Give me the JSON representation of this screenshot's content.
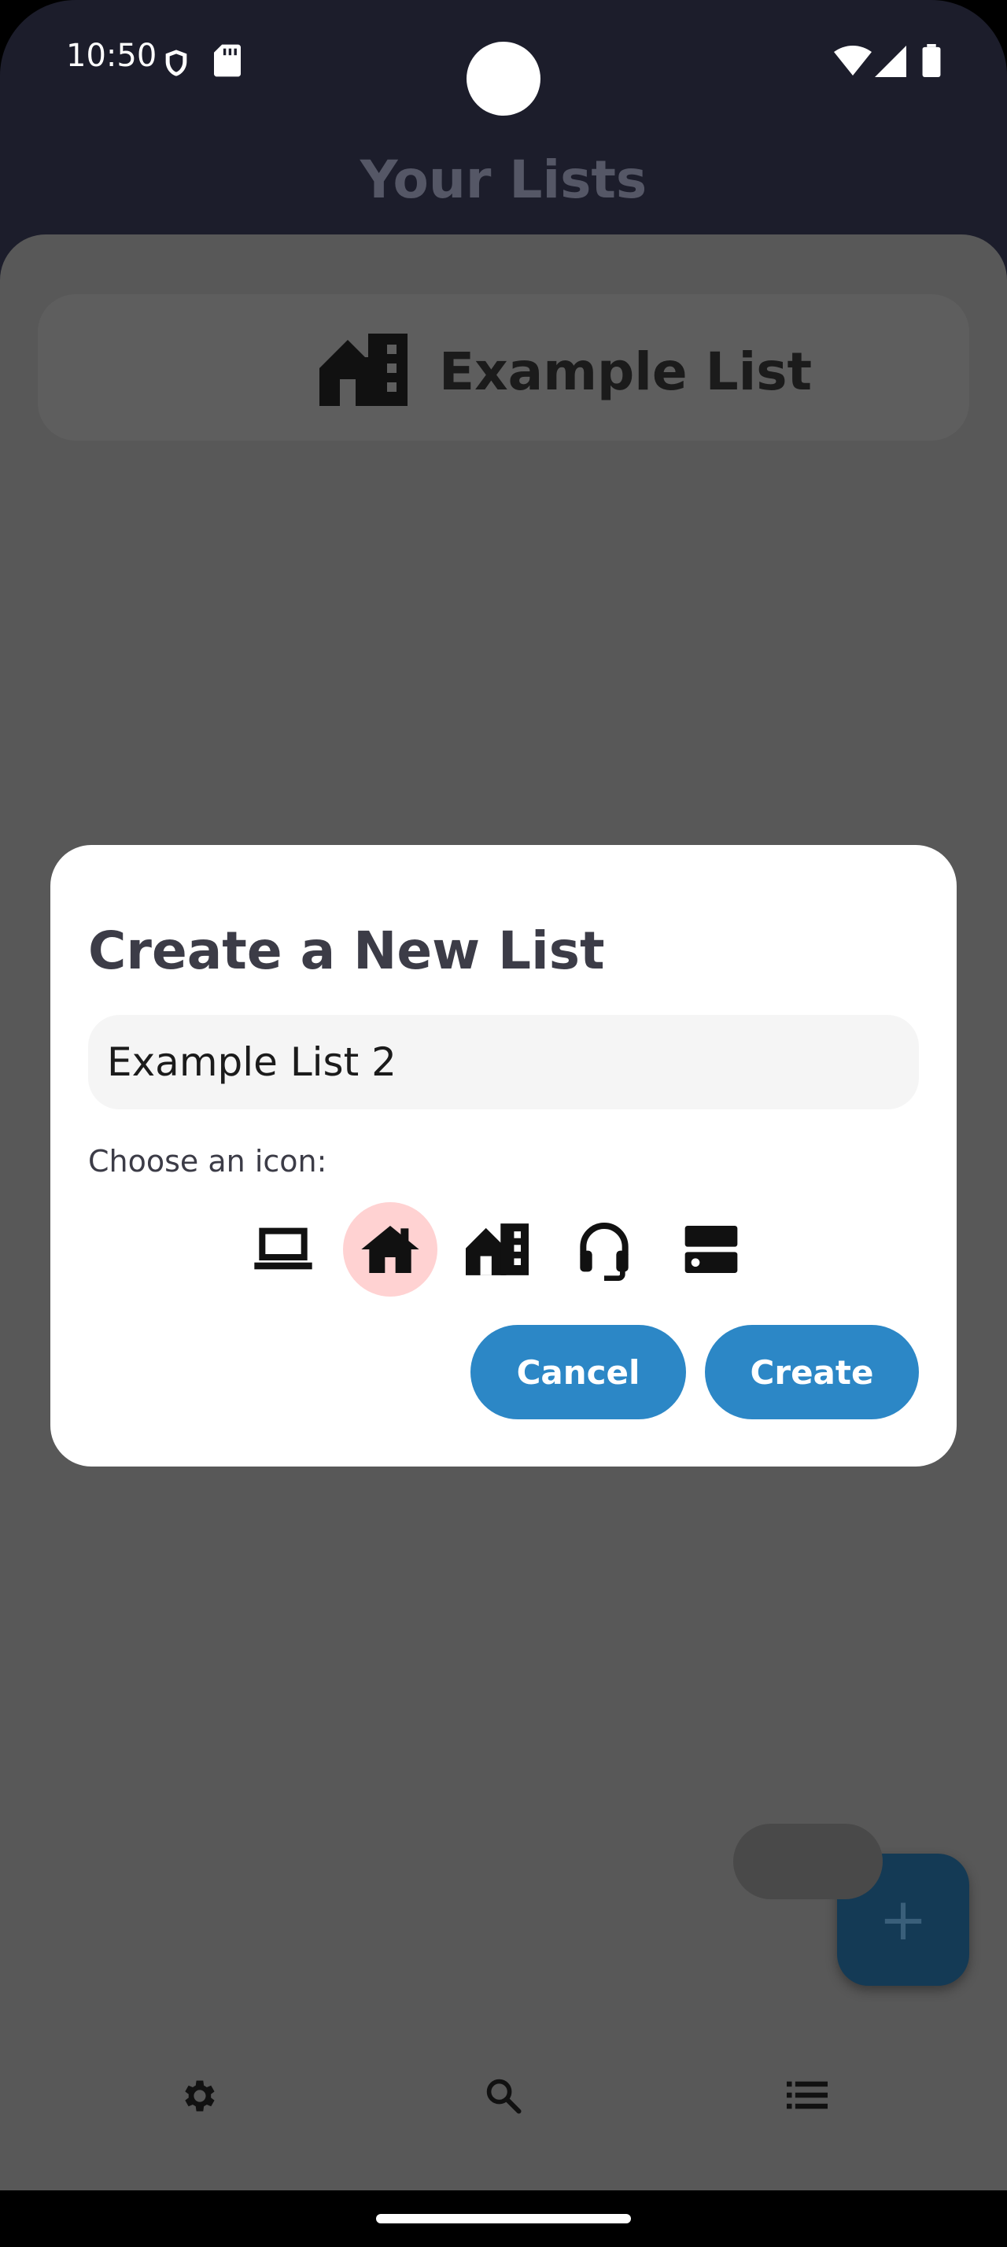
{
  "status_bar": {
    "time": "10:50"
  },
  "app_bar": {
    "title": "Your Lists"
  },
  "lists": [
    {
      "name": "Example List",
      "icon": "apartment-icon"
    }
  ],
  "fab": {
    "label": "+"
  },
  "bottom_nav": [
    {
      "id": "settings",
      "icon": "gear-icon",
      "active": false
    },
    {
      "id": "search",
      "icon": "search-icon",
      "active": false
    },
    {
      "id": "lists",
      "icon": "list-icon",
      "active": true
    }
  ],
  "dialog": {
    "title": "Create a New List",
    "name_value": "Example List 2",
    "choose_label": "Choose an icon:",
    "icons": [
      {
        "icon": "laptop-icon",
        "selected": false
      },
      {
        "icon": "home-icon",
        "selected": true
      },
      {
        "icon": "apartment-icon",
        "selected": false
      },
      {
        "icon": "headset-icon",
        "selected": false
      },
      {
        "icon": "storage-icon",
        "selected": false
      }
    ],
    "cancel_label": "Cancel",
    "create_label": "Create"
  },
  "colors": {
    "accent": "#2c87c6",
    "selected_icon_bg": "#ffd2d2",
    "scrim": "#585858",
    "top_bar": "#1c1d2b"
  }
}
